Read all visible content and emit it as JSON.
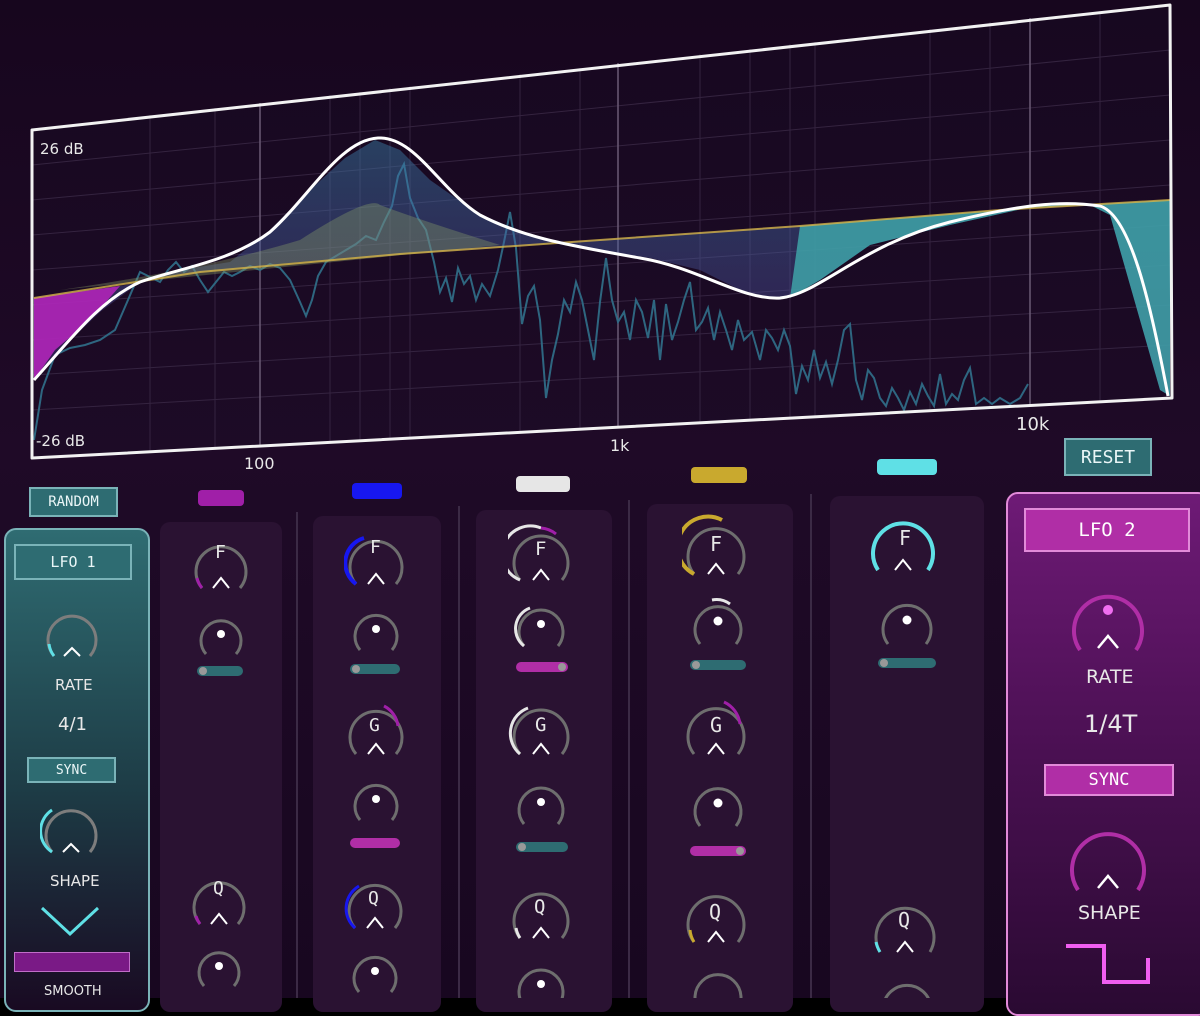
{
  "spectrum": {
    "db_top": "26 dB",
    "db_bottom": "-26 dB",
    "freq_labels": [
      "100",
      "1k",
      "10k"
    ]
  },
  "buttons": {
    "random": "RANDOM",
    "reset": "RESET"
  },
  "lfo1": {
    "title": "LFO 1",
    "rate_label": "RATE",
    "rate_value": "4/1",
    "sync": "SYNC",
    "shape_label": "SHAPE",
    "smooth_label": "SMOOTH"
  },
  "lfo2": {
    "title": "LFO 2",
    "rate_label": "RATE",
    "rate_value": "1/4T",
    "sync": "SYNC",
    "shape_label": "SHAPE"
  },
  "knob_letters": {
    "f": "F",
    "g": "G",
    "q": "Q"
  },
  "colors": {
    "band1": "#a01fa8",
    "band2": "#1717f0",
    "band3": "#e6e6e6",
    "band4": "#c9a92e",
    "band5": "#5fe0e6",
    "teal": "#2e6c72",
    "pink": "#b02ea6",
    "panel": "#1f0a27"
  },
  "icons": [
    "triangle-wave-icon",
    "square-wave-icon"
  ]
}
